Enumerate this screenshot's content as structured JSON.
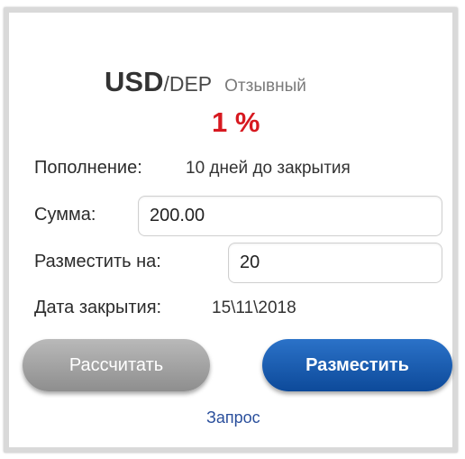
{
  "product": {
    "currency": "USD",
    "currency_suffix": "/DEP",
    "type": "Отзывный",
    "rate": "1 %"
  },
  "replenishment": {
    "label": "Пополнение:",
    "value": "10 дней до закрытия"
  },
  "amount": {
    "label": "Сумма:",
    "value": "200.00"
  },
  "term": {
    "label": "Разместить на:",
    "value": "20"
  },
  "close_date": {
    "label": "Дата закрытия:",
    "value": "15\\11\\2018"
  },
  "actions": {
    "calculate_label": "Рассчитать",
    "place_label": "Разместить",
    "request_label": "Запрос"
  },
  "colors": {
    "rate": "#d71920",
    "primary_button": "#0d4a9a",
    "secondary_button": "#9a9a9a",
    "link": "#2a4f9c"
  }
}
